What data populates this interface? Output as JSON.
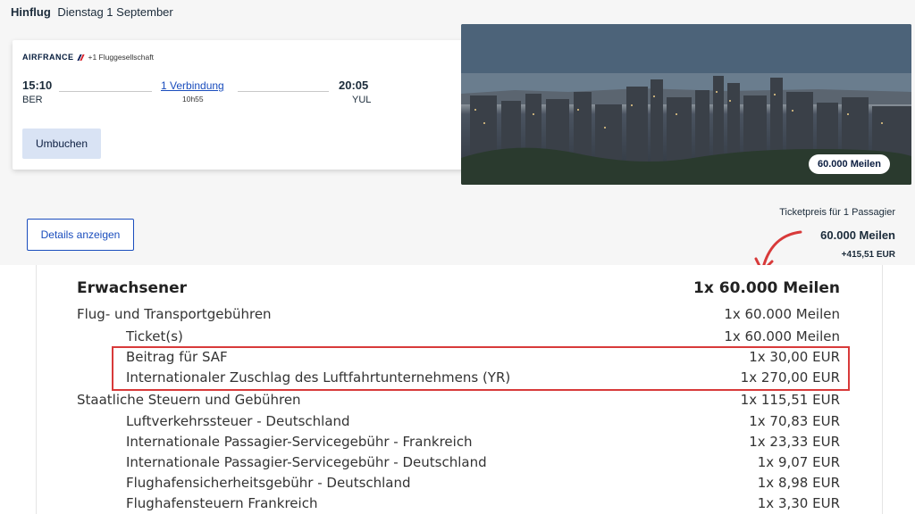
{
  "header": {
    "direction": "Hinflug",
    "date": "Dienstag 1 September"
  },
  "flight": {
    "airline_logo": "AIRFRANCE",
    "airline_extra": "+1 Fluggesellschaft",
    "departure_time": "15:10",
    "departure_code": "BER",
    "arrival_time": "20:05",
    "arrival_code": "YUL",
    "connection_label": "1 Verbindung",
    "duration": "10h55",
    "rebook_label": "Umbuchen"
  },
  "photo": {
    "miles_badge": "60.000  Meilen"
  },
  "details_label": "Details anzeigen",
  "ticket": {
    "label": "Ticketpreis für 1 Passagier",
    "miles": "60.000  Meilen",
    "eur": "+415,51 EUR"
  },
  "breakdown": {
    "rows": [
      {
        "label": "Erwachsener",
        "value": "1x 60.000  Meilen",
        "level": "head"
      },
      {
        "label": "Flug- und Transportgebühren",
        "value": "1x 60.000  Meilen",
        "level": "main"
      },
      {
        "label": "Ticket(s)",
        "value": "1x 60.000  Meilen",
        "level": "sub"
      },
      {
        "label": "Beitrag für SAF",
        "value": "1x 30,00 EUR",
        "level": "sub"
      },
      {
        "label": "Internationaler Zuschlag des Luftfahrtunternehmens (YR)",
        "value": "1x 270,00 EUR",
        "level": "sub"
      },
      {
        "label": "Staatliche Steuern und Gebühren",
        "value": "1x 115,51 EUR",
        "level": "main"
      },
      {
        "label": "Luftverkehrssteuer - Deutschland",
        "value": "1x 70,83 EUR",
        "level": "sub"
      },
      {
        "label": "Internationale Passagier-Servicegebühr - Frankreich",
        "value": "1x 23,33 EUR",
        "level": "sub"
      },
      {
        "label": "Internationale Passagier-Servicegebühr - Deutschland",
        "value": "1x 9,07 EUR",
        "level": "sub"
      },
      {
        "label": "Flughafensicherheitsgebühr - Deutschland",
        "value": "1x 8,98 EUR",
        "level": "sub"
      },
      {
        "label": "Flughafensteuern Frankreich",
        "value": "1x 3,30 EUR",
        "level": "sub"
      }
    ]
  },
  "colors": {
    "accent": "#1a4dbd",
    "highlight": "#d83a3a",
    "button_bg": "#d9e3f4"
  }
}
